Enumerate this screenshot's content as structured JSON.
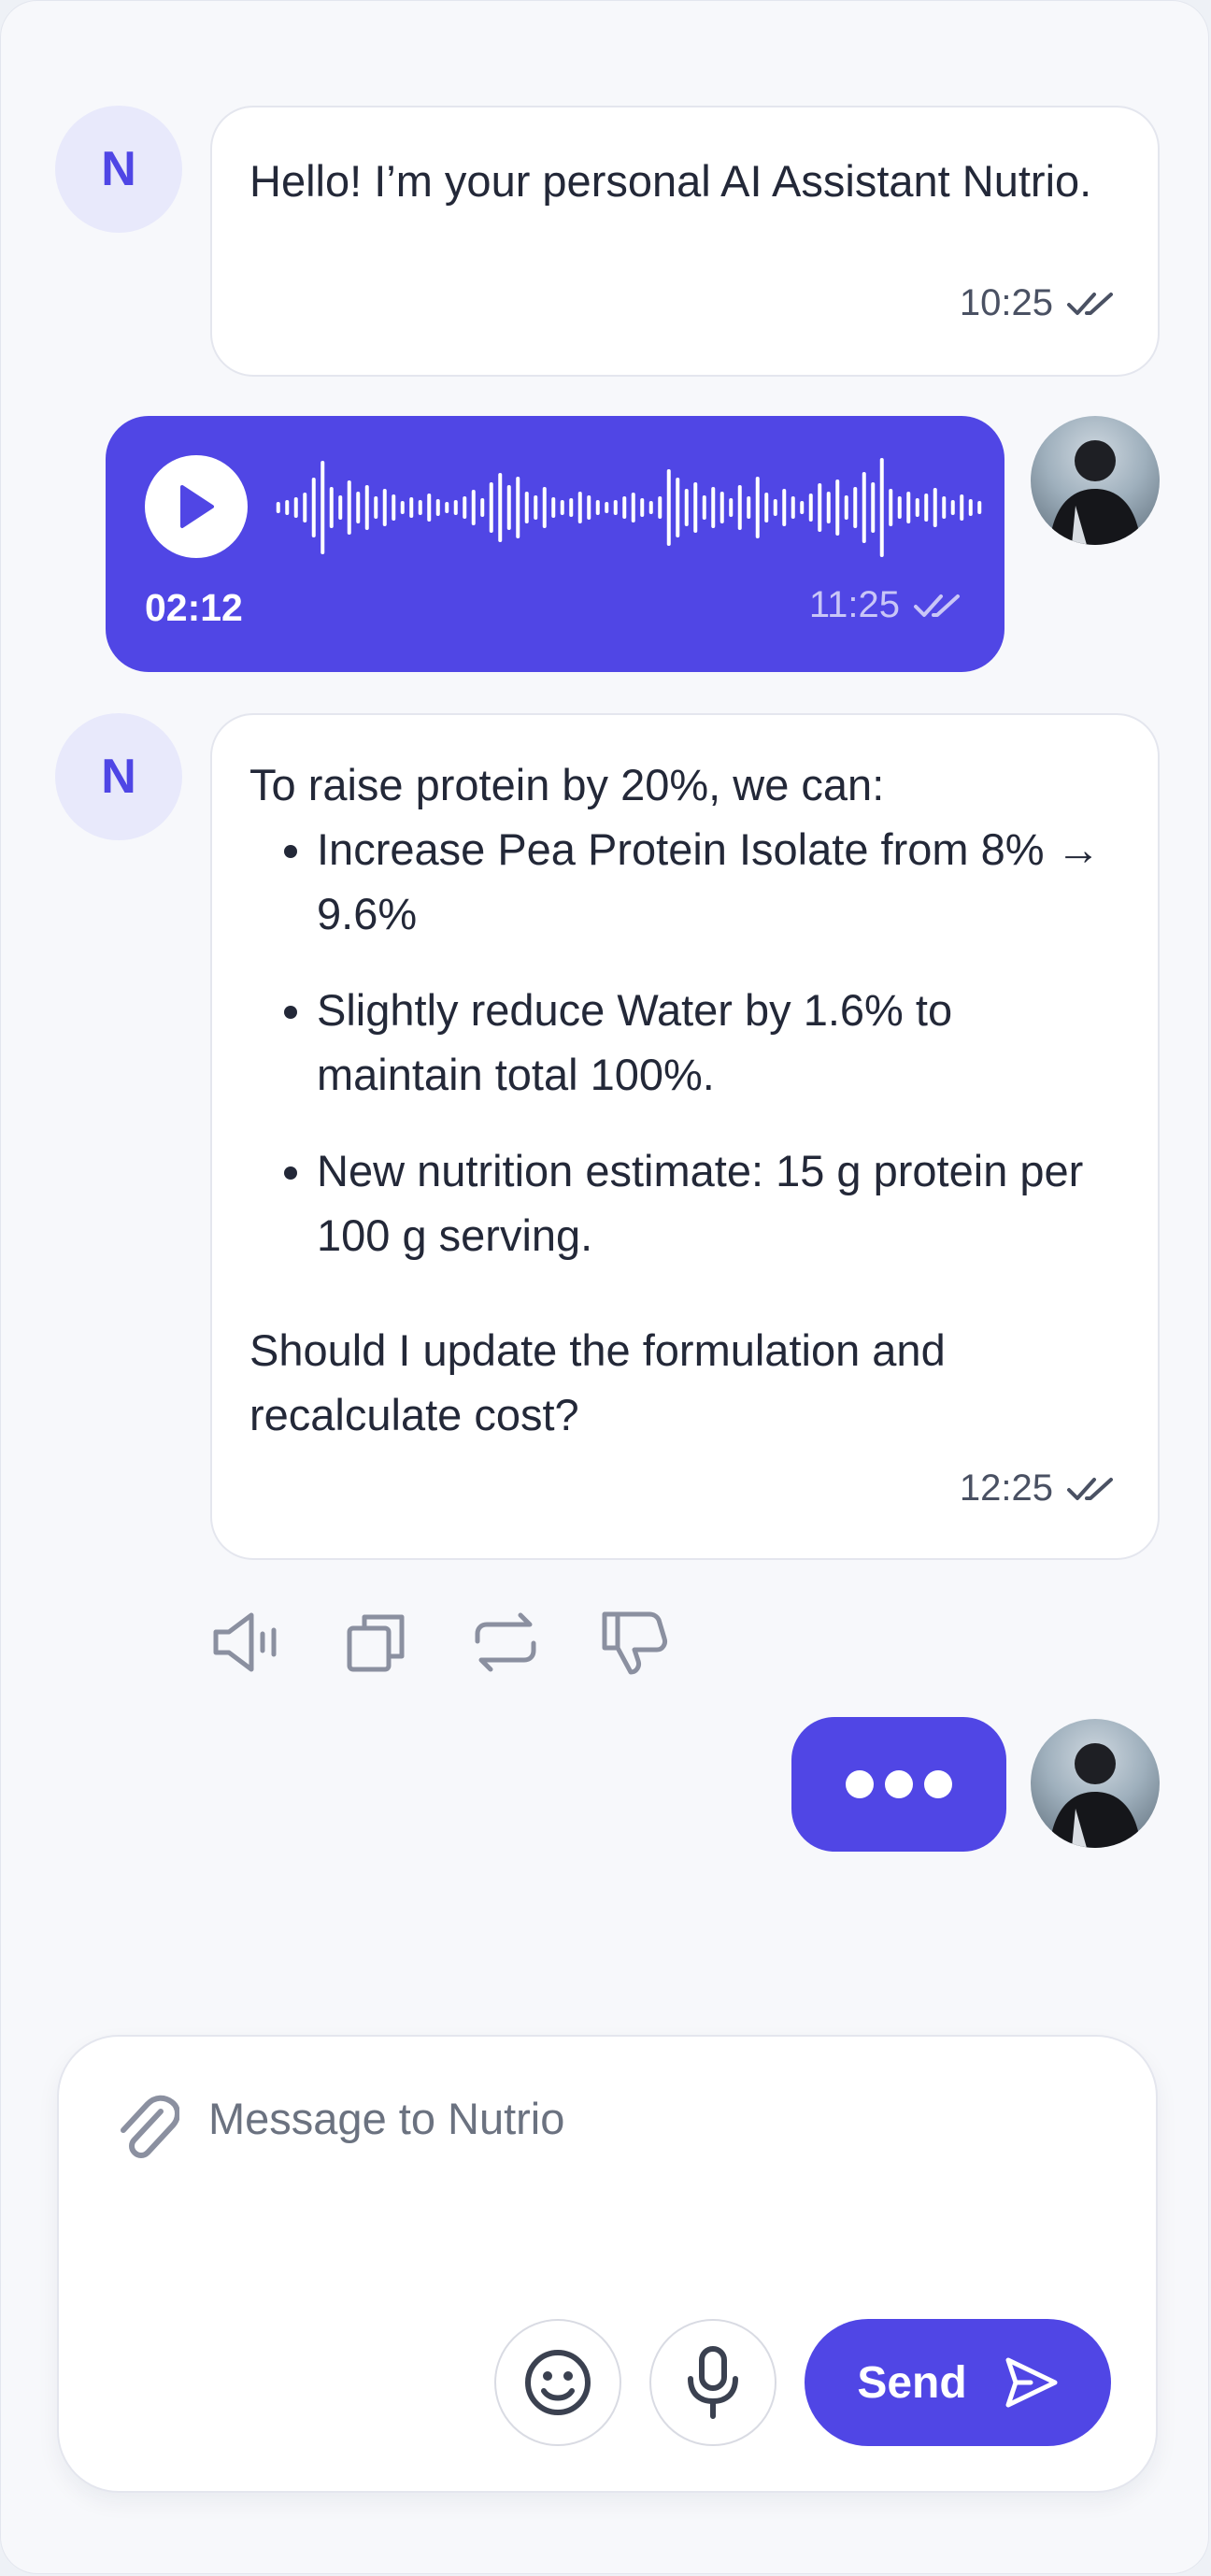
{
  "messages": [
    {
      "sender": "assistant",
      "avatar_letter": "N",
      "text": "Hello! I’m your personal AI Assistant Nutrio.",
      "time": "10:25",
      "status_icon": "double-check-icon"
    },
    {
      "sender": "user",
      "type": "voice",
      "duration": "02:12",
      "time": "11:25",
      "status_icon": "double-check-icon",
      "icons": [
        "play-icon",
        "waveform"
      ]
    },
    {
      "sender": "assistant",
      "avatar_letter": "N",
      "intro": "To raise protein by 20%, we can:",
      "bullets": [
        "Increase Pea Protein Isolate from 8% → 9.6%",
        "Slightly reduce Water by 1.6% to maintain total 100%.",
        "New nutrition estimate: 15 g protein per 100 g serving."
      ],
      "question": "Should I update the formulation and recalculate cost?",
      "time": "12:25",
      "status_icon": "double-check-icon"
    },
    {
      "sender": "user",
      "type": "typing",
      "icon": "typing-dots"
    }
  ],
  "message_actions": [
    "speaker-icon",
    "copy-icon",
    "regenerate-icon",
    "thumbs-down-icon"
  ],
  "composer": {
    "placeholder": "Message to Nutrio",
    "send_label": "Send",
    "icons": [
      "paperclip-icon",
      "emoji-icon",
      "microphone-icon",
      "send-arrow-icon"
    ]
  },
  "colors": {
    "accent": "#5046e5",
    "avatar_bg": "#e8e9fb",
    "background": "#f7f8fb",
    "bubble_border": "#e4e6ee"
  }
}
